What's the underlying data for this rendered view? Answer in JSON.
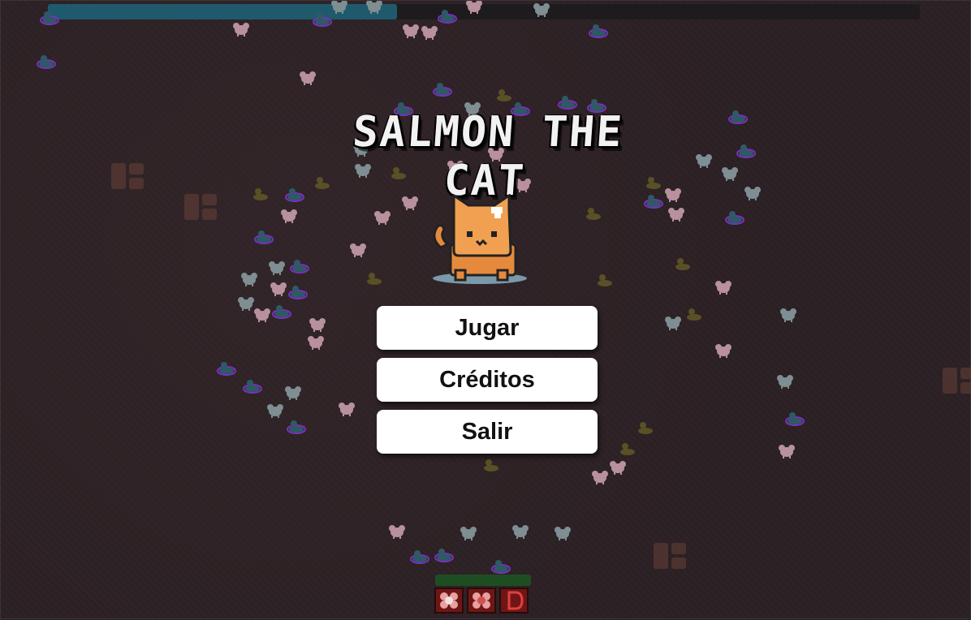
{
  "game": {
    "title": "SALMON THE CAT",
    "xp_progress": 0.4
  },
  "menu": {
    "play_label": "Jugar",
    "credits_label": "Créditos",
    "exit_label": "Salir"
  },
  "hud": {
    "health_fraction": 1.0,
    "slots": [
      "flower-icon",
      "flower-icon",
      "letter-d-icon"
    ]
  },
  "colors": {
    "background": "#2b2023",
    "xp_bar": "#1f5a6c",
    "health_bar": "#1e4d22",
    "slot": "#6e1616",
    "cat_orange": "#f0a050",
    "button_bg": "#ffffff"
  }
}
